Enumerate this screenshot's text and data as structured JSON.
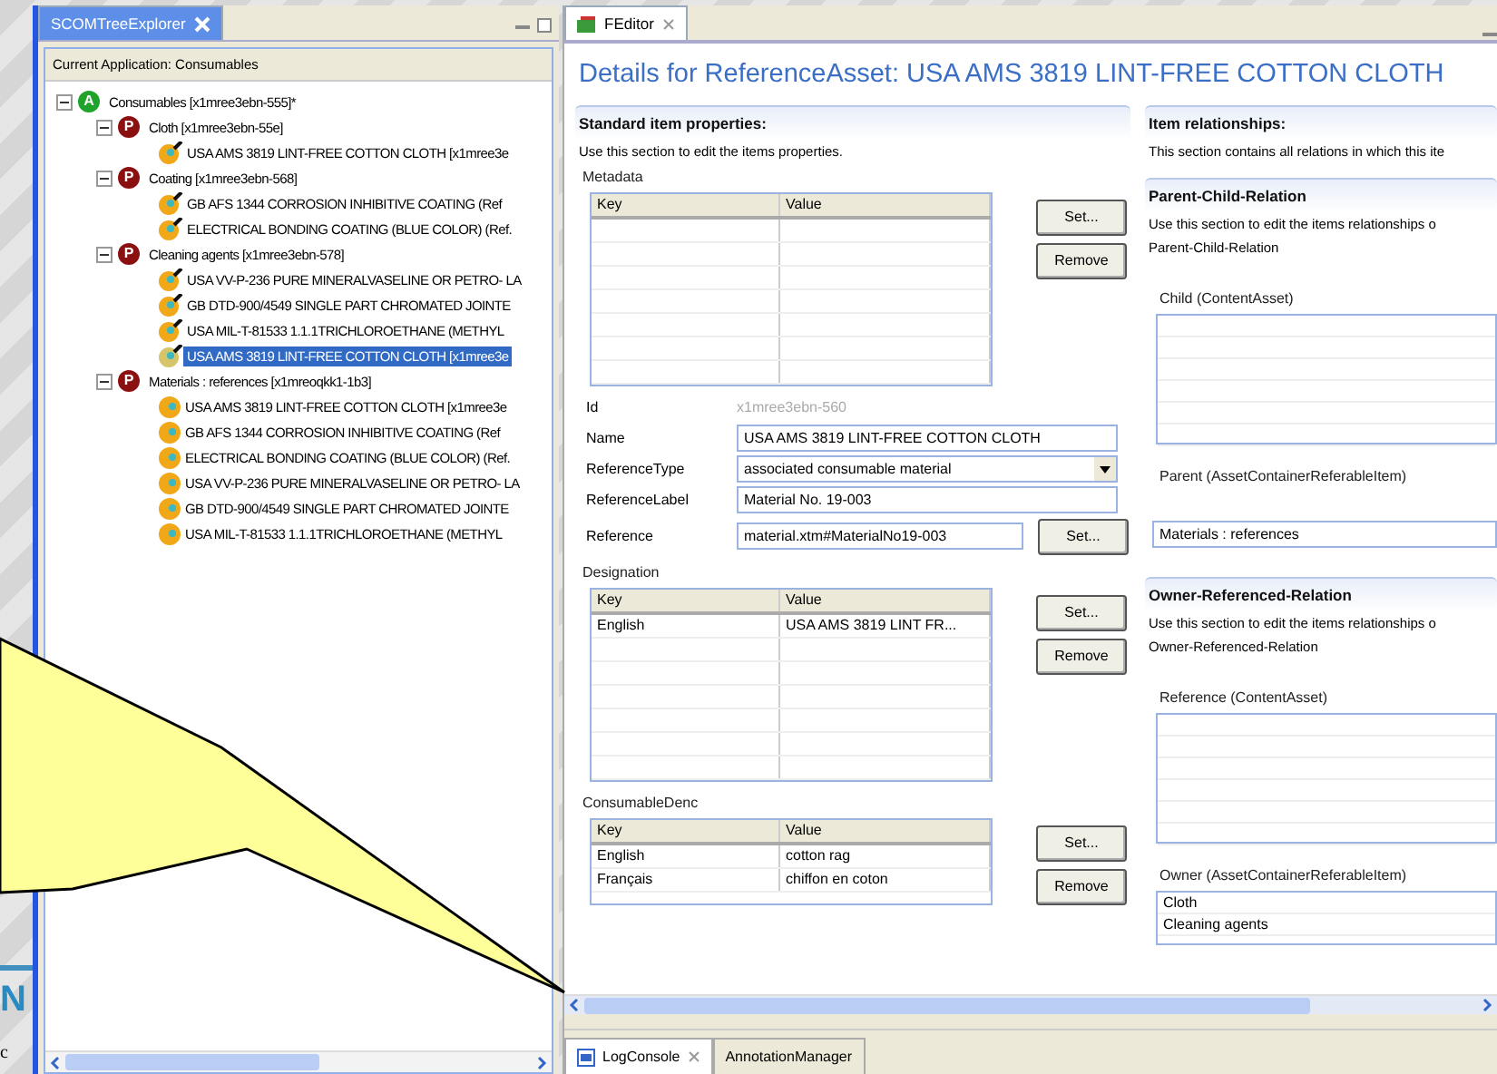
{
  "slide": {
    "heading_fragment": "N",
    "text_fragment": "c"
  },
  "tree_view": {
    "tab": {
      "label": "SCOMTreeExplorer",
      "selected": true
    },
    "header": "Current Application: Consumables",
    "nodes": [
      {
        "kind": "application",
        "badge": "A",
        "label": "Consumables [x1mree3ebn-555]*",
        "expanded": true,
        "selected": false,
        "children": [
          {
            "kind": "category",
            "badge": "P",
            "label": "Cloth [x1mree3ebn-55e]",
            "expanded": true,
            "selected": false,
            "children": [
              {
                "kind": "reference",
                "label": "USA AMS 3819 LINT-FREE COTTON CLOTH  [x1mree3e",
                "selected": false
              }
            ]
          },
          {
            "kind": "category",
            "badge": "P",
            "label": "Coating [x1mree3ebn-568]",
            "expanded": true,
            "selected": false,
            "children": [
              {
                "kind": "reference",
                "label": "GB  AFS 1344 CORROSION INHIBITIVE COATING (Ref",
                "selected": false
              },
              {
                "kind": "reference",
                "label": "ELECTRICAL BONDING COATING (BLUE COLOR) (Ref.",
                "selected": false
              }
            ]
          },
          {
            "kind": "category",
            "badge": "P",
            "label": "Cleaning agents [x1mree3ebn-578]",
            "expanded": true,
            "selected": false,
            "children": [
              {
                "kind": "reference",
                "label": "USA VV-P-236 PURE MINERALVASELINE OR PETRO- LA",
                "selected": false
              },
              {
                "kind": "reference",
                "label": "GB  DTD-900/4549 SINGLE PART CHROMATED JOINTE",
                "selected": false
              },
              {
                "kind": "reference",
                "label": "USA MIL-T-81533 1.1.1TRICHLOROETHANE (METHYL",
                "selected": false
              },
              {
                "kind": "reference",
                "label": "USA AMS 3819 LINT-FREE COTTON CLOTH  [x1mree3e",
                "selected": true
              }
            ]
          },
          {
            "kind": "category",
            "badge": "P",
            "label": "Materials : references [x1mreoqkk1-1b3]",
            "expanded": true,
            "selected": false,
            "children": [
              {
                "kind": "material",
                "label": "USA AMS 3819 LINT-FREE COTTON CLOTH  [x1mree3e",
                "selected": false
              },
              {
                "kind": "material",
                "label": "GB  AFS 1344 CORROSION INHIBITIVE COATING (Ref",
                "selected": false
              },
              {
                "kind": "material",
                "label": "ELECTRICAL BONDING COATING (BLUE COLOR) (Ref.",
                "selected": false
              },
              {
                "kind": "material",
                "label": "USA VV-P-236 PURE MINERALVASELINE OR PETRO- LA",
                "selected": false
              },
              {
                "kind": "material",
                "label": "GB  DTD-900/4549 SINGLE PART CHROMATED JOINTE",
                "selected": false
              },
              {
                "kind": "material",
                "label": "USA MIL-T-81533 1.1.1TRICHLOROETHANE (METHYL",
                "selected": false
              }
            ]
          }
        ]
      }
    ]
  },
  "editor": {
    "tab": {
      "label": "FEditor",
      "selected": true
    },
    "title": "Details for ReferenceAsset: USA AMS 3819 LINT-FREE COTTON CLOTH",
    "properties": {
      "heading": "Standard item properties:",
      "description": "Use this section to edit the items properties.",
      "metadata": {
        "label": "Metadata",
        "columns": [
          "Key",
          "Value"
        ],
        "buttons": [
          "Set...",
          "Remove"
        ]
      },
      "fields": [
        {
          "kind": "readonly",
          "label": "Id",
          "value": "x1mree3ebn-560"
        },
        {
          "kind": "text",
          "label": "Name",
          "value": "USA AMS 3819 LINT-FREE COTTON CLOTH"
        },
        {
          "kind": "dropdown",
          "label": "ReferenceType",
          "value": "associated consumable material"
        },
        {
          "kind": "text",
          "label": "ReferenceLabel",
          "value": "Material No. 19-003"
        },
        {
          "kind": "button_text",
          "label": "Reference",
          "value": "material.xtm#MaterialNo19-003",
          "button": "Set..."
        }
      ],
      "designation": {
        "label": "Designation",
        "columns": [
          "Key",
          "Value"
        ],
        "rows": [
          [
            "English",
            "USA AMS 3819 LINT FR..."
          ]
        ],
        "buttons": [
          "Set...",
          "Remove"
        ]
      },
      "consumable_denc": {
        "label": "ConsumableDenc",
        "columns": [
          "Key",
          "Value"
        ],
        "rows": [
          [
            "English",
            "cotton rag"
          ],
          [
            "Français",
            "chiffon en coton"
          ]
        ],
        "buttons": [
          "Set...",
          "Remove"
        ]
      }
    },
    "relationships": {
      "heading": "Item relationships:",
      "description": "This section contains all relations in which this ite",
      "sections": [
        {
          "heading": "Parent-Child-Relation",
          "description": [
            "Use this section to edit the items relationships o",
            "Parent-Child-Relation"
          ],
          "lists": [
            {
              "kind": "list",
              "label": "Child (ContentAsset)"
            },
            {
              "kind": "field",
              "label": "Parent (AssetContainerReferableItem)",
              "items": [
                "Materials : references"
              ]
            }
          ]
        },
        {
          "heading": "Owner-Referenced-Relation",
          "description": [
            "Use this section to edit the items relationships o",
            "Owner-Referenced-Relation"
          ],
          "lists": [
            {
              "kind": "list",
              "label": "Reference (ContentAsset)"
            },
            {
              "kind": "list",
              "label": "Owner (AssetContainerReferableItem)",
              "items": [
                "Cloth",
                "Cleaning agents"
              ]
            }
          ]
        }
      ]
    }
  },
  "bottom_tabs": [
    {
      "label": "LogConsole",
      "selected": true
    },
    {
      "label": "AnnotationManager",
      "selected": false
    }
  ]
}
